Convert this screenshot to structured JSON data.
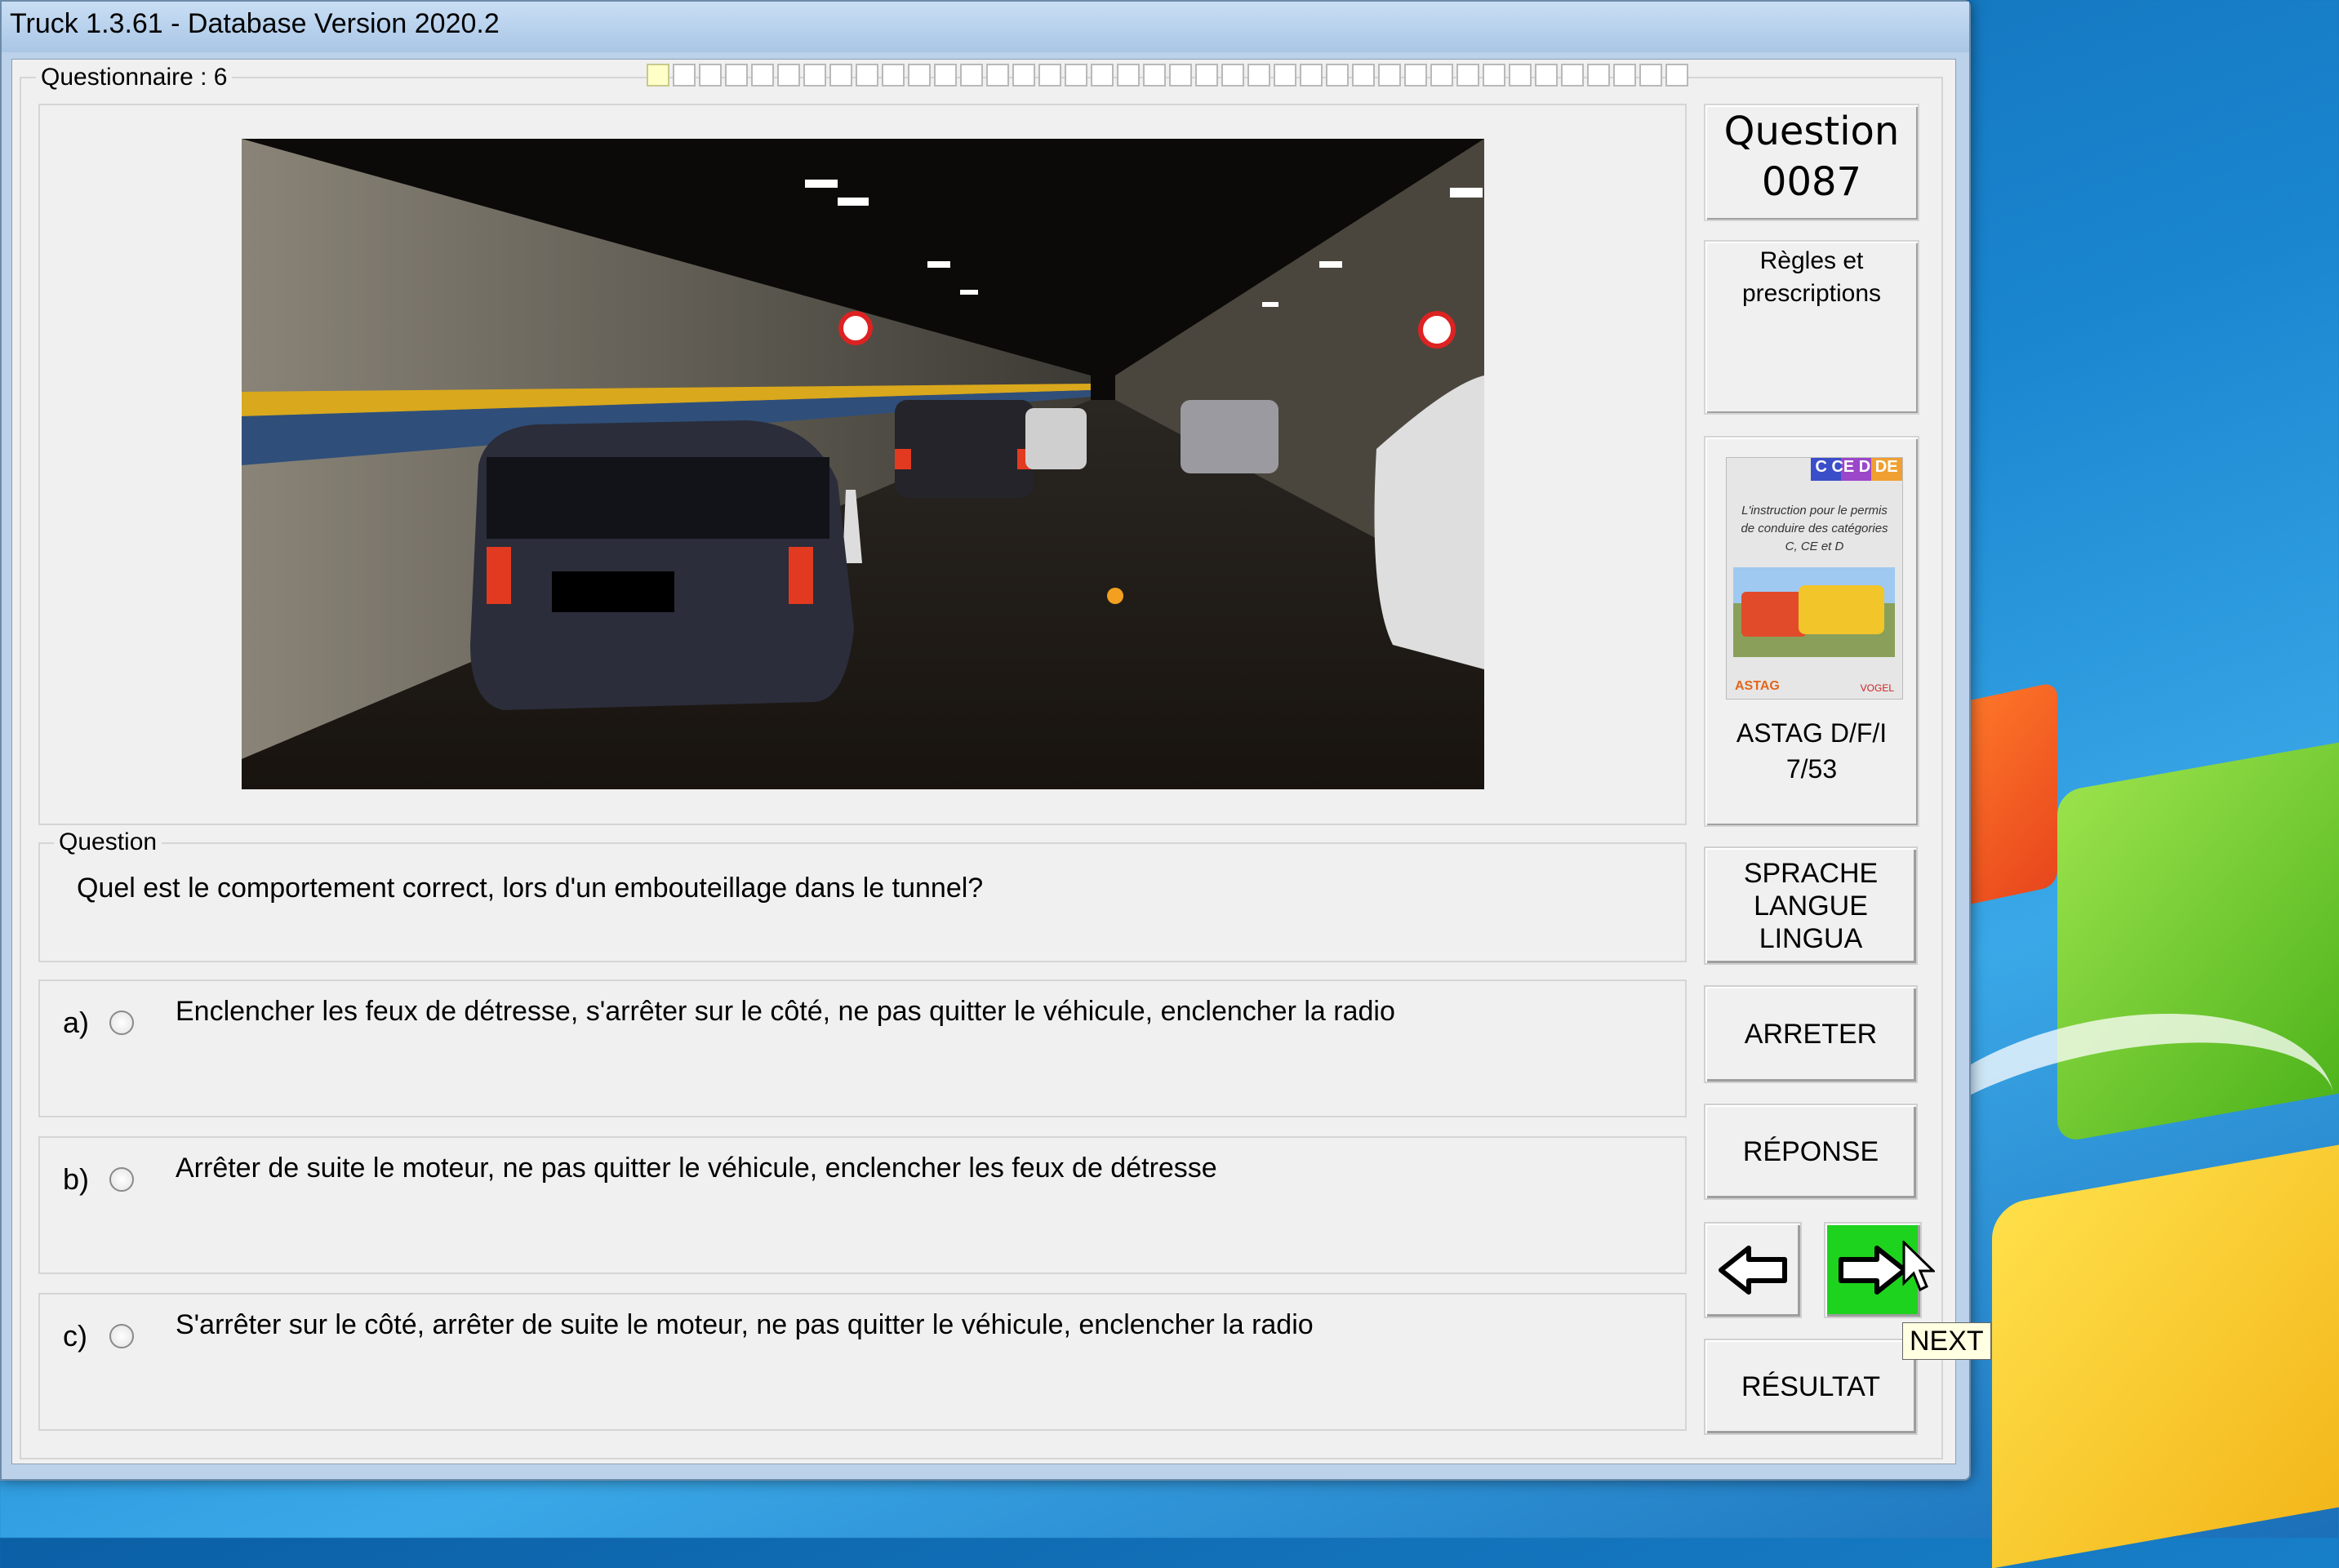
{
  "window": {
    "title": "Truck 1.3.61 - Database Version 2020.2"
  },
  "questionnaire": {
    "label": "Questionnaire : 6",
    "progress_total": 40,
    "progress_done": 1
  },
  "question_section": {
    "legend": "Question",
    "text": "Quel est le comportement correct, lors d'un embouteillage dans le tunnel?"
  },
  "answers": [
    {
      "letter": "a)",
      "text": "Enclencher les feux de détresse, s'arrêter sur le côté, ne pas quitter le véhicule, enclencher la radio"
    },
    {
      "letter": "b)",
      "text": "Arrêter de suite le moteur, ne pas quitter le véhicule, enclencher les feux de détresse"
    },
    {
      "letter": "c)",
      "text": "S'arrêter sur le côté, arrêter de suite le moteur, ne pas quitter le véhicule, enclencher la radio"
    }
  ],
  "sidebar": {
    "question_label": "Question",
    "question_number": "0087",
    "topic_line1": "Règles et",
    "topic_line2": "prescriptions",
    "book": {
      "tag": "C CE D DE",
      "text": "L'instruction pour le permis de conduire des catégories C, CE et D",
      "logo": "ASTAG",
      "logo2": "VOGEL"
    },
    "reference_line1": "ASTAG D/F/I",
    "reference_line2": "7/53",
    "language_line1": "SPRACHE",
    "language_line2": "LANGUE",
    "language_line3": "LINGUA",
    "stop_label": "ARRETER",
    "answer_label": "RÉPONSE",
    "result_label": "RÉSULTAT",
    "next_tooltip": "NEXT"
  },
  "icons": {
    "prev": "arrow-left-icon",
    "next": "arrow-right-icon"
  },
  "colors": {
    "next_button": "#1ed31e",
    "progress_done": "#ffffc8"
  }
}
